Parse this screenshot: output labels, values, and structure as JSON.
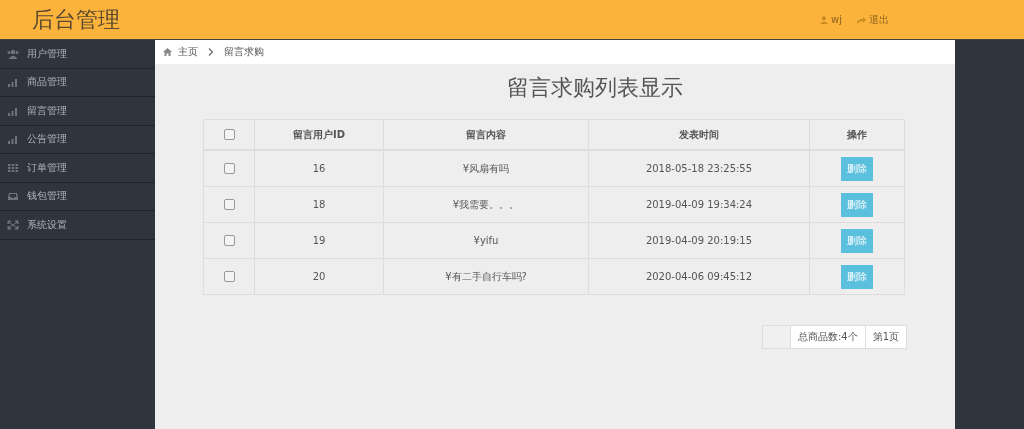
{
  "header": {
    "title": "后台管理",
    "user": "wj",
    "logout": "退出"
  },
  "sidebar": {
    "items": [
      {
        "label": "用户管理",
        "kind": "users"
      },
      {
        "label": "商品管理",
        "kind": "bars"
      },
      {
        "label": "留言管理",
        "kind": "bars"
      },
      {
        "label": "公告管理",
        "kind": "bars"
      },
      {
        "label": "订单管理",
        "kind": "grid"
      },
      {
        "label": "钱包管理",
        "kind": "inbox"
      },
      {
        "label": "系统设置",
        "kind": "arrows"
      }
    ]
  },
  "breadcrumb": [
    "主页",
    "留言求购"
  ],
  "page_title": "留言求购列表显示",
  "table": {
    "select_all": {
      "checked": false
    },
    "columns": [
      "留言用户ID",
      "留言内容",
      "发表时间",
      "操作"
    ],
    "rows": [
      {
        "checked": false,
        "user_id": "16",
        "content": "¥风扇有吗",
        "time": "2018-05-18 23:25:55",
        "action": "删除"
      },
      {
        "checked": false,
        "user_id": "18",
        "content": "¥我需要。。。",
        "time": "2019-04-09 19:34:24",
        "action": "删除"
      },
      {
        "checked": false,
        "user_id": "19",
        "content": "¥yifu",
        "time": "2019-04-09 20:19:15",
        "action": "删除"
      },
      {
        "checked": false,
        "user_id": "20",
        "content": "¥有二手自行车吗?",
        "time": "2020-04-06 09:45:12",
        "action": "删除"
      }
    ]
  },
  "pagination": {
    "total": "总商品数:4个",
    "page": "第1页"
  }
}
